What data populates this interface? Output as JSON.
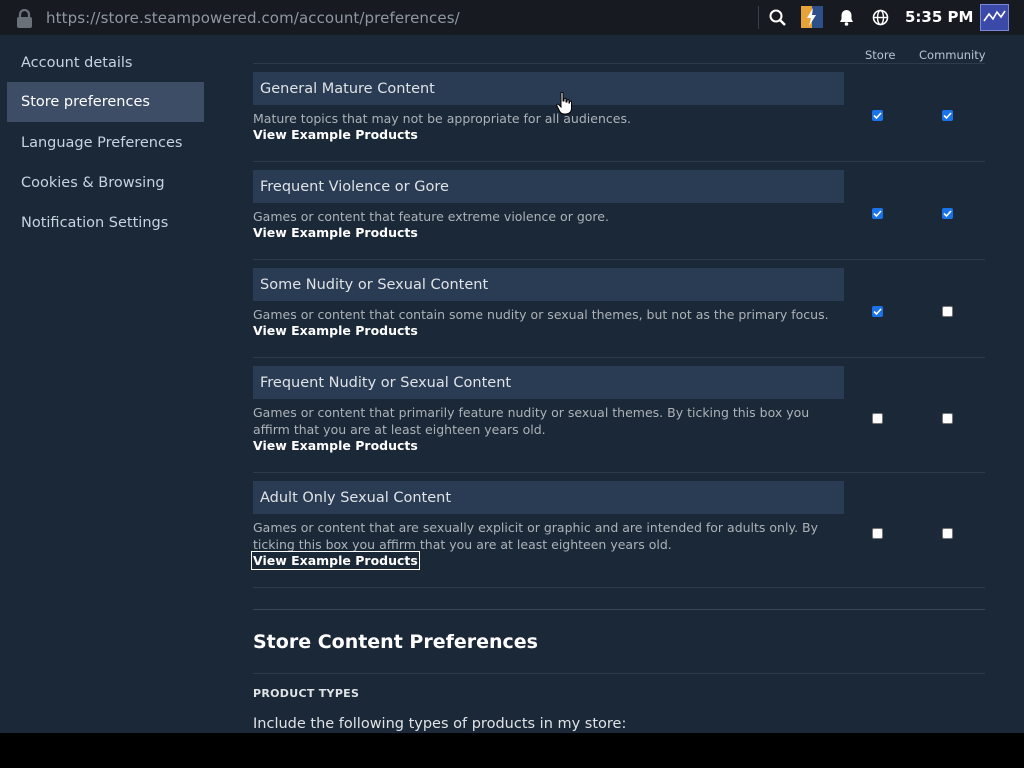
{
  "browser": {
    "url": "https://store.steampowered.com/account/preferences/",
    "clock": "5:35 PM",
    "tray_icons": [
      "search-icon",
      "game-app-icon",
      "bell-icon",
      "globe-icon",
      "avatar"
    ]
  },
  "sidebar": {
    "items": [
      {
        "label": "Account details",
        "active": false
      },
      {
        "label": "Store preferences",
        "active": true
      },
      {
        "label": "Language Preferences",
        "active": false
      },
      {
        "label": "Cookies & Browsing",
        "active": false
      },
      {
        "label": "Notification Settings",
        "active": false
      }
    ]
  },
  "columns": {
    "store": "Store",
    "community": "Community"
  },
  "categories": [
    {
      "title": "General Mature Content",
      "desc": "Mature topics that may not be appropriate for all audiences.",
      "link": "View Example Products",
      "store": true,
      "community": true
    },
    {
      "title": "Frequent Violence or Gore",
      "desc": "Games or content that feature extreme violence or gore.",
      "link": "View Example Products",
      "store": true,
      "community": true
    },
    {
      "title": "Some Nudity or Sexual Content",
      "desc": "Games or content that contain some nudity or sexual themes, but not as the primary focus.",
      "link": "View Example Products",
      "store": true,
      "community": false
    },
    {
      "title": "Frequent Nudity or Sexual Content",
      "desc": "Games or content that primarily feature nudity or sexual themes. By ticking this box you affirm that you are at least eighteen years old.",
      "link": "View Example Products",
      "store": false,
      "community": false
    },
    {
      "title": "Adult Only Sexual Content",
      "desc": "Games or content that are sexually explicit or graphic and are intended for adults only. By ticking this box you affirm that you are at least eighteen years old.",
      "link": "View Example Products",
      "store": false,
      "community": false
    }
  ],
  "store_content": {
    "title": "Store Content Preferences",
    "subhead": "PRODUCT TYPES",
    "include_text": "Include the following types of products in my store:"
  },
  "colors": {
    "page_bg": "#1b2838",
    "topbar_bg": "#171a21",
    "category_bar": "#2a3b54",
    "sidebar_active": "#3d4d65",
    "checkbox_checked": "#1a73e8"
  }
}
